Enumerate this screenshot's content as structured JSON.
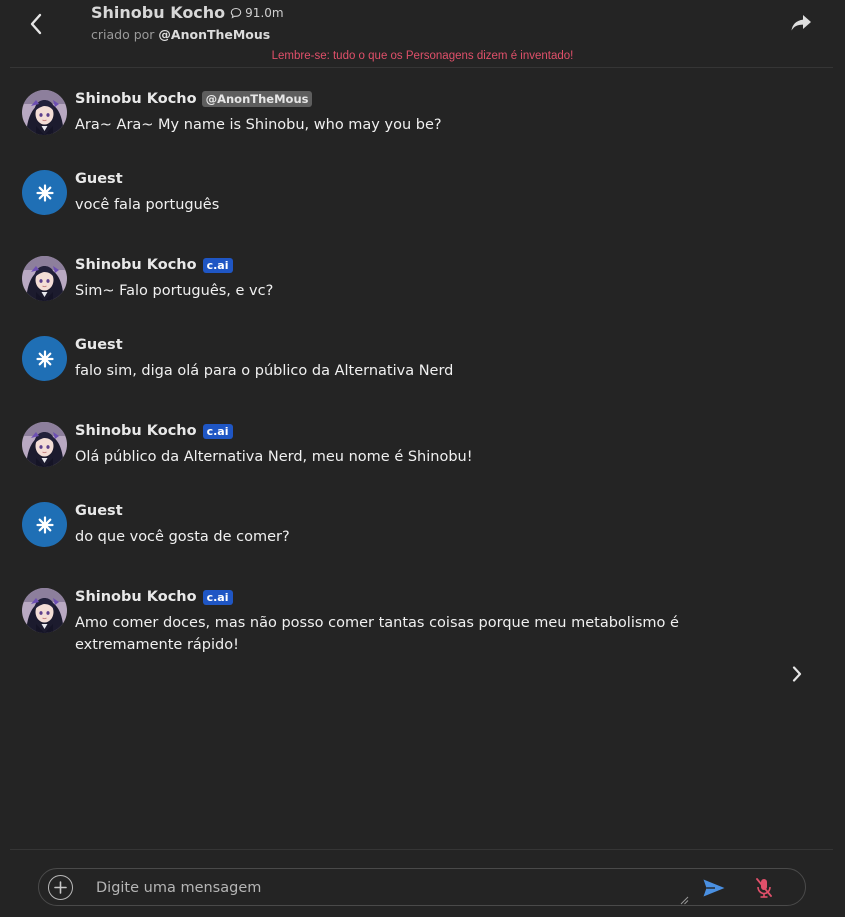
{
  "header": {
    "title": "Shinobu Kocho",
    "chat_count": "91.0m",
    "creator_prefix": "criado por",
    "creator": "@AnonTheMous",
    "disclaimer": "Lembre-se: tudo o que os Personagens dizem é inventado!"
  },
  "messages": [
    {
      "author": "Shinobu Kocho",
      "badge": "@AnonTheMous",
      "badge_type": "creator",
      "avatar": "character",
      "text": "Ara~ Ara~ My name is Shinobu, who may you be?"
    },
    {
      "author": "Guest",
      "badge": "",
      "badge_type": "none",
      "avatar": "guest",
      "text": "você fala português"
    },
    {
      "author": "Shinobu Kocho",
      "badge": "c.ai",
      "badge_type": "cai",
      "avatar": "character",
      "text": "Sim~ Falo português, e vc?"
    },
    {
      "author": "Guest",
      "badge": "",
      "badge_type": "none",
      "avatar": "guest",
      "text": "falo sim, diga olá para o público da Alternativa Nerd"
    },
    {
      "author": "Shinobu Kocho",
      "badge": "c.ai",
      "badge_type": "cai",
      "avatar": "character",
      "text": "Olá público da Alternativa Nerd, meu nome é Shinobu!"
    },
    {
      "author": "Guest",
      "badge": "",
      "badge_type": "none",
      "avatar": "guest",
      "text": "do que você gosta de comer?"
    },
    {
      "author": "Shinobu Kocho",
      "badge": "c.ai",
      "badge_type": "cai",
      "avatar": "character",
      "text": "Amo comer doces, mas não posso comer tantas coisas porque meu metabolismo é extremamente rápido!"
    }
  ],
  "input": {
    "placeholder": "Digite uma mensagem",
    "value": ""
  },
  "icons": {
    "back": "chevron-left-icon",
    "share": "share-arrow-icon",
    "chat_count": "chat-bubble-icon",
    "next": "chevron-right-icon",
    "add": "plus-circle-icon",
    "send": "send-icon",
    "mic": "mic-off-icon",
    "guest_avatar": "sparkle-icon"
  },
  "colors": {
    "background": "#242424",
    "disclaimer": "#e0506a",
    "cai_badge": "#1f56c4",
    "guest_avatar": "#1f6fb5",
    "send": "#4a90e2",
    "mic_off": "#e0506a"
  }
}
